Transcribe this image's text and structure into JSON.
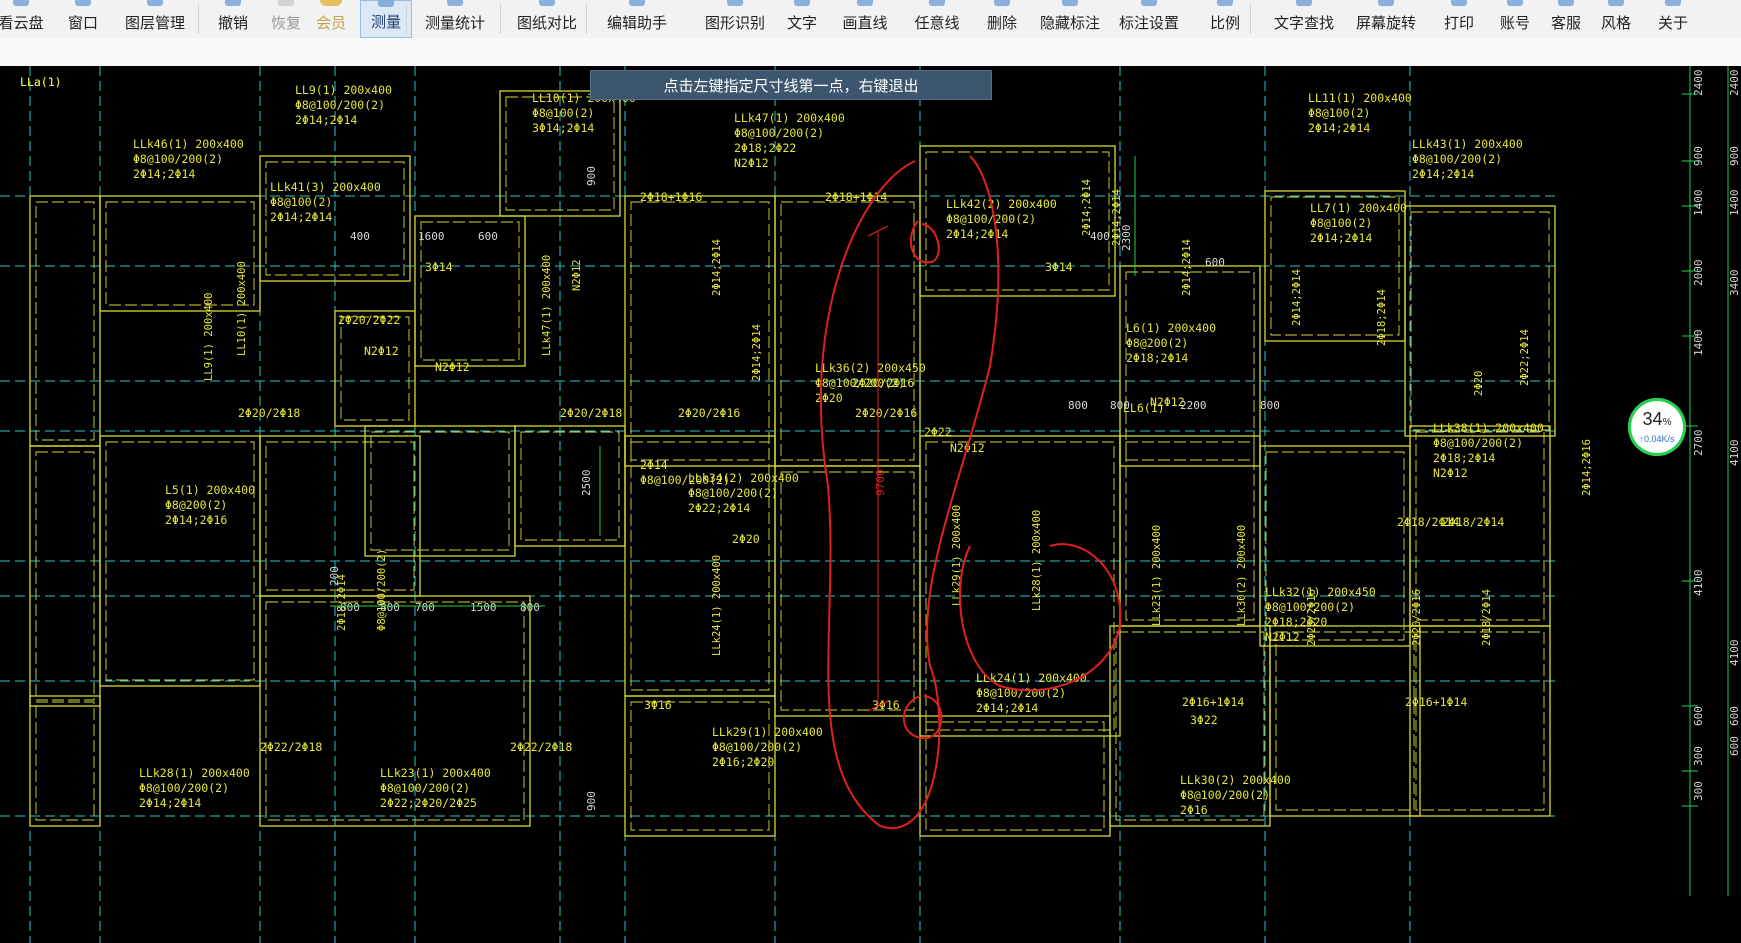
{
  "toolbar": {
    "items": [
      {
        "label": "看云盘",
        "state": "normal"
      },
      {
        "label": "窗口",
        "state": "normal"
      },
      {
        "label": "图层管理",
        "state": "normal"
      },
      {
        "label": "撤销",
        "state": "normal"
      },
      {
        "label": "恢复",
        "state": "disabled"
      },
      {
        "label": "会员",
        "state": "vip"
      },
      {
        "label": "测量",
        "state": "active"
      },
      {
        "label": "测量统计",
        "state": "normal"
      },
      {
        "label": "图纸对比",
        "state": "normal"
      },
      {
        "label": "编辑助手",
        "state": "normal"
      },
      {
        "label": "图形识别",
        "state": "normal"
      },
      {
        "label": "文字",
        "state": "normal"
      },
      {
        "label": "画直线",
        "state": "normal"
      },
      {
        "label": "任意线",
        "state": "normal"
      },
      {
        "label": "删除",
        "state": "normal"
      },
      {
        "label": "隐藏标注",
        "state": "normal"
      },
      {
        "label": "标注设置",
        "state": "normal"
      },
      {
        "label": "比例",
        "state": "normal"
      },
      {
        "label": "文字查找",
        "state": "normal"
      },
      {
        "label": "屏幕旋转",
        "state": "normal"
      },
      {
        "label": "打印",
        "state": "normal"
      },
      {
        "label": "账号",
        "state": "normal"
      },
      {
        "label": "客服",
        "state": "normal"
      },
      {
        "label": "风格",
        "state": "normal"
      },
      {
        "label": "关于",
        "state": "normal"
      }
    ]
  },
  "hint": "点击左键指定尺寸线第一点，右键退出",
  "network": {
    "percent": "34",
    "percent_unit": "%",
    "speed": "↑0.04K/s"
  },
  "drawing": {
    "labels": [
      {
        "t": "LL9(1) 200x400"
      },
      {
        "t": "Φ8@100/200(2)"
      },
      {
        "t": "2Φ14;2Φ14"
      },
      {
        "t": "LL10(1) 200x400"
      },
      {
        "t": "Φ8@100(2)"
      },
      {
        "t": "3Φ14;2Φ14"
      },
      {
        "t": "LLk47(1) 200x400"
      },
      {
        "t": "Φ8@100/200(2)"
      },
      {
        "t": "2Φ18;2Φ22"
      },
      {
        "t": "N2Φ12"
      },
      {
        "t": "LLk46(1) 200x400"
      },
      {
        "t": "Φ8@100/200(2)"
      },
      {
        "t": "2Φ14;2Φ14"
      },
      {
        "t": "LLk41(3) 200x400"
      },
      {
        "t": "Φ8@100(2)"
      },
      {
        "t": "2Φ14;2Φ14"
      },
      {
        "t": "LLk42(2) 200x400"
      },
      {
        "t": "Φ8@100/200(2)"
      },
      {
        "t": "2Φ14;2Φ14"
      },
      {
        "t": "LL11(1) 200x400"
      },
      {
        "t": "Φ8@100(2)"
      },
      {
        "t": "2Φ14;2Φ14"
      },
      {
        "t": "LLk43(1) 200x400"
      },
      {
        "t": "Φ8@100/200(2)"
      },
      {
        "t": "2Φ14;2Φ14"
      },
      {
        "t": "LL7(1) 200x400"
      },
      {
        "t": "Φ8@100(2)"
      },
      {
        "t": "2Φ14;2Φ14"
      },
      {
        "t": "L6(1) 200x400"
      },
      {
        "t": "Φ8@200(2)"
      },
      {
        "t": "2Φ18;2Φ14"
      },
      {
        "t": "LLk36(2) 200x450"
      },
      {
        "t": "Φ8@100/200(2)"
      },
      {
        "t": "2Φ20"
      },
      {
        "t": "LLk34(2) 200x400"
      },
      {
        "t": "Φ8@100/200(2)"
      },
      {
        "t": "2Φ22;2Φ14"
      },
      {
        "t": "L5(1) 200x400"
      },
      {
        "t": "Φ8@200(2)"
      },
      {
        "t": "2Φ14;2Φ16"
      },
      {
        "t": "LLk38(1) 200x400"
      },
      {
        "t": "Φ8@100/200(2)"
      },
      {
        "t": "2Φ18;2Φ14"
      },
      {
        "t": "N2Φ12"
      },
      {
        "t": "LLk32(1) 200x450"
      },
      {
        "t": "Φ8@100/200(2)"
      },
      {
        "t": "2Φ18;2Φ20"
      },
      {
        "t": "N2Φ12"
      },
      {
        "t": "LLk24(1) 200x400"
      },
      {
        "t": "Φ8@100/200(2)"
      },
      {
        "t": "2Φ14;2Φ14"
      },
      {
        "t": "LLk29(1) 200x400"
      },
      {
        "t": "Φ8@100/200(2)"
      },
      {
        "t": "2Φ16;2Φ20"
      },
      {
        "t": "LLk28(1) 200x400"
      },
      {
        "t": "Φ8@100/200(2)"
      },
      {
        "t": "2Φ14;2Φ14"
      },
      {
        "t": "LLk23(1) 200x400"
      },
      {
        "t": "Φ8@100/200(2)"
      },
      {
        "t": "2Φ22;2Φ20/2Φ25"
      },
      {
        "t": "LLk30(2) 200x400"
      },
      {
        "t": "Φ8@100/200(2)"
      },
      {
        "t": "2Φ16"
      },
      {
        "t": "2Φ20/2Φ16"
      },
      {
        "t": "2Φ20/2Φ18"
      },
      {
        "t": "2Φ20/2Φ18"
      },
      {
        "t": "2Φ20/2Φ16"
      },
      {
        "t": "2Φ20/2Φ16"
      },
      {
        "t": "2Φ18/2Φ14"
      },
      {
        "t": "2Φ18/2Φ14"
      },
      {
        "t": "2Φ22/2Φ18"
      },
      {
        "t": "2Φ22/2Φ18"
      },
      {
        "t": "2Φ16+1Φ14"
      },
      {
        "t": "2Φ16+1Φ14"
      },
      {
        "t": "2Φ18+1Φ16"
      },
      {
        "t": "2Φ18+1Φ14"
      },
      {
        "t": "3Φ14"
      },
      {
        "t": "3Φ14"
      },
      {
        "t": "3Φ16"
      },
      {
        "t": "3Φ16"
      },
      {
        "t": "2Φ20"
      },
      {
        "t": "2Φ14"
      },
      {
        "t": "3Φ22"
      },
      {
        "t": "2Φ22"
      },
      {
        "t": "N2Φ12"
      },
      {
        "t": "2Φ20/2Φ22"
      },
      {
        "t": "N2Φ12"
      },
      {
        "t": "Φ8@100/200(2)"
      },
      {
        "t": "N2Φ12"
      },
      {
        "t": "N2Φ12"
      },
      {
        "t": "LL6(1)"
      },
      {
        "t": "LLa(1)"
      },
      {
        "t": "LLa(1)"
      }
    ],
    "dims": [
      {
        "t": "1600"
      },
      {
        "t": "600"
      },
      {
        "t": "400"
      },
      {
        "t": "400"
      },
      {
        "t": "800"
      },
      {
        "t": "800"
      },
      {
        "t": "700"
      },
      {
        "t": "1500"
      },
      {
        "t": "800"
      },
      {
        "t": "800"
      },
      {
        "t": "800"
      },
      {
        "t": "2200"
      },
      {
        "t": "800"
      },
      {
        "t": "600"
      },
      {
        "t": "900"
      },
      {
        "t": "900"
      },
      {
        "t": "2500"
      },
      {
        "t": "200"
      },
      {
        "t": "2300"
      }
    ],
    "right_dims": [
      {
        "t": "2400"
      },
      {
        "t": "900"
      },
      {
        "t": "1400"
      },
      {
        "t": "2000"
      },
      {
        "t": "1400"
      },
      {
        "t": "2700"
      },
      {
        "t": "4100"
      },
      {
        "t": "600"
      },
      {
        "t": "300"
      },
      {
        "t": "300"
      }
    ],
    "right_dims2": [
      {
        "t": "2400"
      },
      {
        "t": "900"
      },
      {
        "t": "1400"
      },
      {
        "t": "3400"
      },
      {
        "t": "4100"
      },
      {
        "t": "4100"
      },
      {
        "t": "600"
      },
      {
        "t": "600"
      }
    ],
    "measure": "9700"
  },
  "colors": {
    "beam": "#d8d830",
    "axis": "#2ec4c4",
    "text": "#e6e63c",
    "dim": "#d8d8d8",
    "dim_line": "#22d04a",
    "markup": "#e02020"
  }
}
